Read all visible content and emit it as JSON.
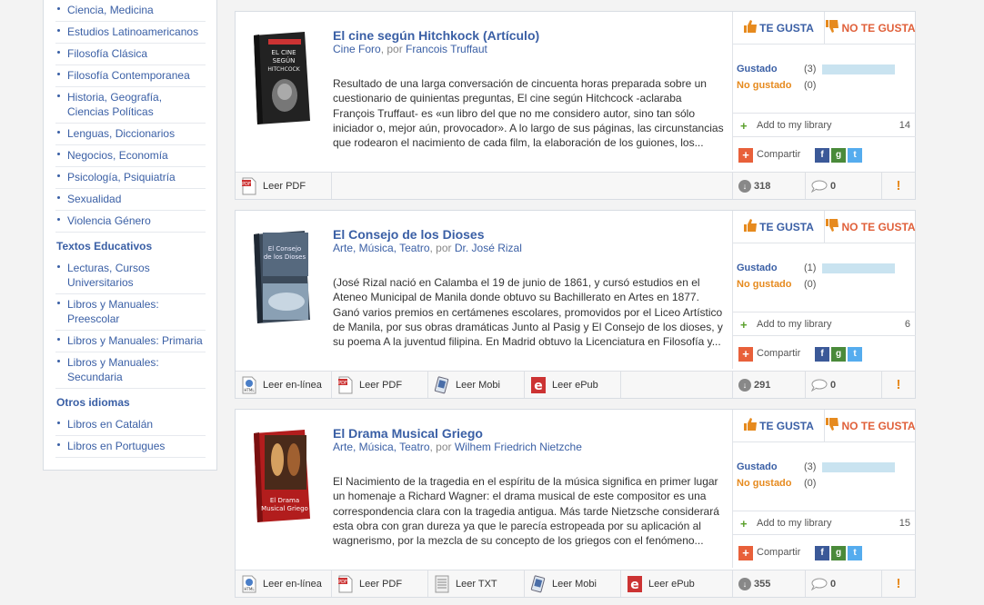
{
  "sidebar": {
    "top_items": [
      "Ciencia, Medicina",
      "Estudios Latinoamericanos",
      "Filosofía Clásica",
      "Filosofía Contemporanea",
      "Historia, Geografía, Ciencias Políticas",
      "Lenguas, Diccionarios",
      "Negocios, Economía",
      "Psicología, Psiquiatría",
      "Sexualidad",
      "Violencia Género"
    ],
    "section2_title": "Textos Educativos",
    "section2_items": [
      "Lecturas, Cursos Universitarios",
      "Libros y Manuales: Preescolar",
      "Libros y Manuales: Primaria",
      "Libros y Manuales: Secundaria"
    ],
    "section3_title": "Otros idiomas",
    "section3_items": [
      "Libros en Catalán",
      "Libros en Portugues"
    ]
  },
  "labels": {
    "like": "TE GUSTA",
    "dislike": "NO TE GUSTA",
    "liked": "Gustado",
    "not_liked": "No gustado",
    "add_library": "Add to my library",
    "share": "Compartir"
  },
  "colors": {
    "link": "#3a5fa5",
    "orange": "#e68a1e",
    "bar": "#c9e3f0"
  },
  "books": [
    {
      "title": "El cine según Hitchkock (Artículo)",
      "source": "Cine Foro",
      "by": ", por ",
      "author": "Francois Truffaut",
      "description": "Resultado de una larga conversación de cincuenta horas preparada sobre un cuestionario de quinientas preguntas, El cine según Hitchcock -aclaraba François Truffaut- es «un libro del que no me considero autor, sino tan sólo iniciador o, mejor aún, provocador». A lo largo de sus páginas, las circunstancias que rodearon el nacimiento de cada film, la elaboración de los guiones, los...",
      "liked": "(3)",
      "not_liked": "(0)",
      "library_count": "14",
      "downloads": "318",
      "comments": "0",
      "formats": [
        "Leer PDF"
      ]
    },
    {
      "title": "El Consejo de los Dioses",
      "source": "Arte, Música, Teatro",
      "by": ", por ",
      "author": "Dr. José Rizal",
      "description": "(José Rizal nació en Calamba el 19 de junio de 1861, y cursó estudios en el Ateneo Municipal de Manila donde obtuvo su Bachillerato en Artes en 1877. Ganó varios premios en certámenes escolares, promovidos por el Liceo Artístico de Manila, por sus obras dramáticas Junto al Pasig y El Consejo de los dioses, y su poema A la juventud filipina. En Madrid obtuvo la Licenciatura en Filosofía y...",
      "liked": "(1)",
      "not_liked": "(0)",
      "library_count": "6",
      "downloads": "291",
      "comments": "0",
      "formats": [
        "Leer en-línea",
        "Leer PDF",
        "Leer Mobi",
        "Leer ePub"
      ]
    },
    {
      "title": "El Drama Musical Griego",
      "source": "Arte, Música, Teatro",
      "by": ", por ",
      "author": "Wilhem Friedrich Nietzche",
      "description": "El Nacimiento de la tragedia en el espíritu de la música significa en primer lugar un homenaje a Richard Wagner: el drama musical de este compositor es una correspondencia clara con la tragedia antigua. Más tarde Nietzsche considerará esta obra con gran dureza ya que le parecía estropeada por su aplicación al wagnerismo, por la mezcla de su concepto de los griegos con el fenómeno...",
      "liked": "(3)",
      "not_liked": "(0)",
      "library_count": "15",
      "downloads": "355",
      "comments": "0",
      "formats": [
        "Leer en-línea",
        "Leer PDF",
        "Leer TXT",
        "Leer Mobi",
        "Leer ePub"
      ]
    }
  ],
  "report_symbol": "!"
}
